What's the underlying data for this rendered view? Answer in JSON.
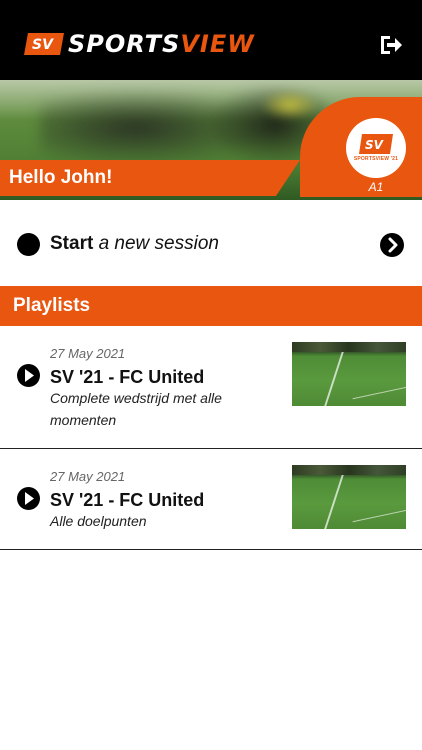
{
  "header": {
    "logo_sports": "SPORTS",
    "logo_view": "VIEW",
    "brand_color": "#e8560f",
    "logout_icon": "logout-icon"
  },
  "hero": {
    "greeting": "Hello John!",
    "team_badge_text": "SPORTSVIEW '21",
    "team_code": "A1"
  },
  "start": {
    "bold": "Start",
    "rest": " a new session"
  },
  "playlists": {
    "heading": "Playlists",
    "items": [
      {
        "date": "27 May 2021",
        "title": "SV '21 - FC United",
        "description": "Complete wedstrijd met alle momenten"
      },
      {
        "date": "27 May 2021",
        "title": "SV '21 - FC United",
        "description": "Alle doelpunten"
      }
    ]
  }
}
